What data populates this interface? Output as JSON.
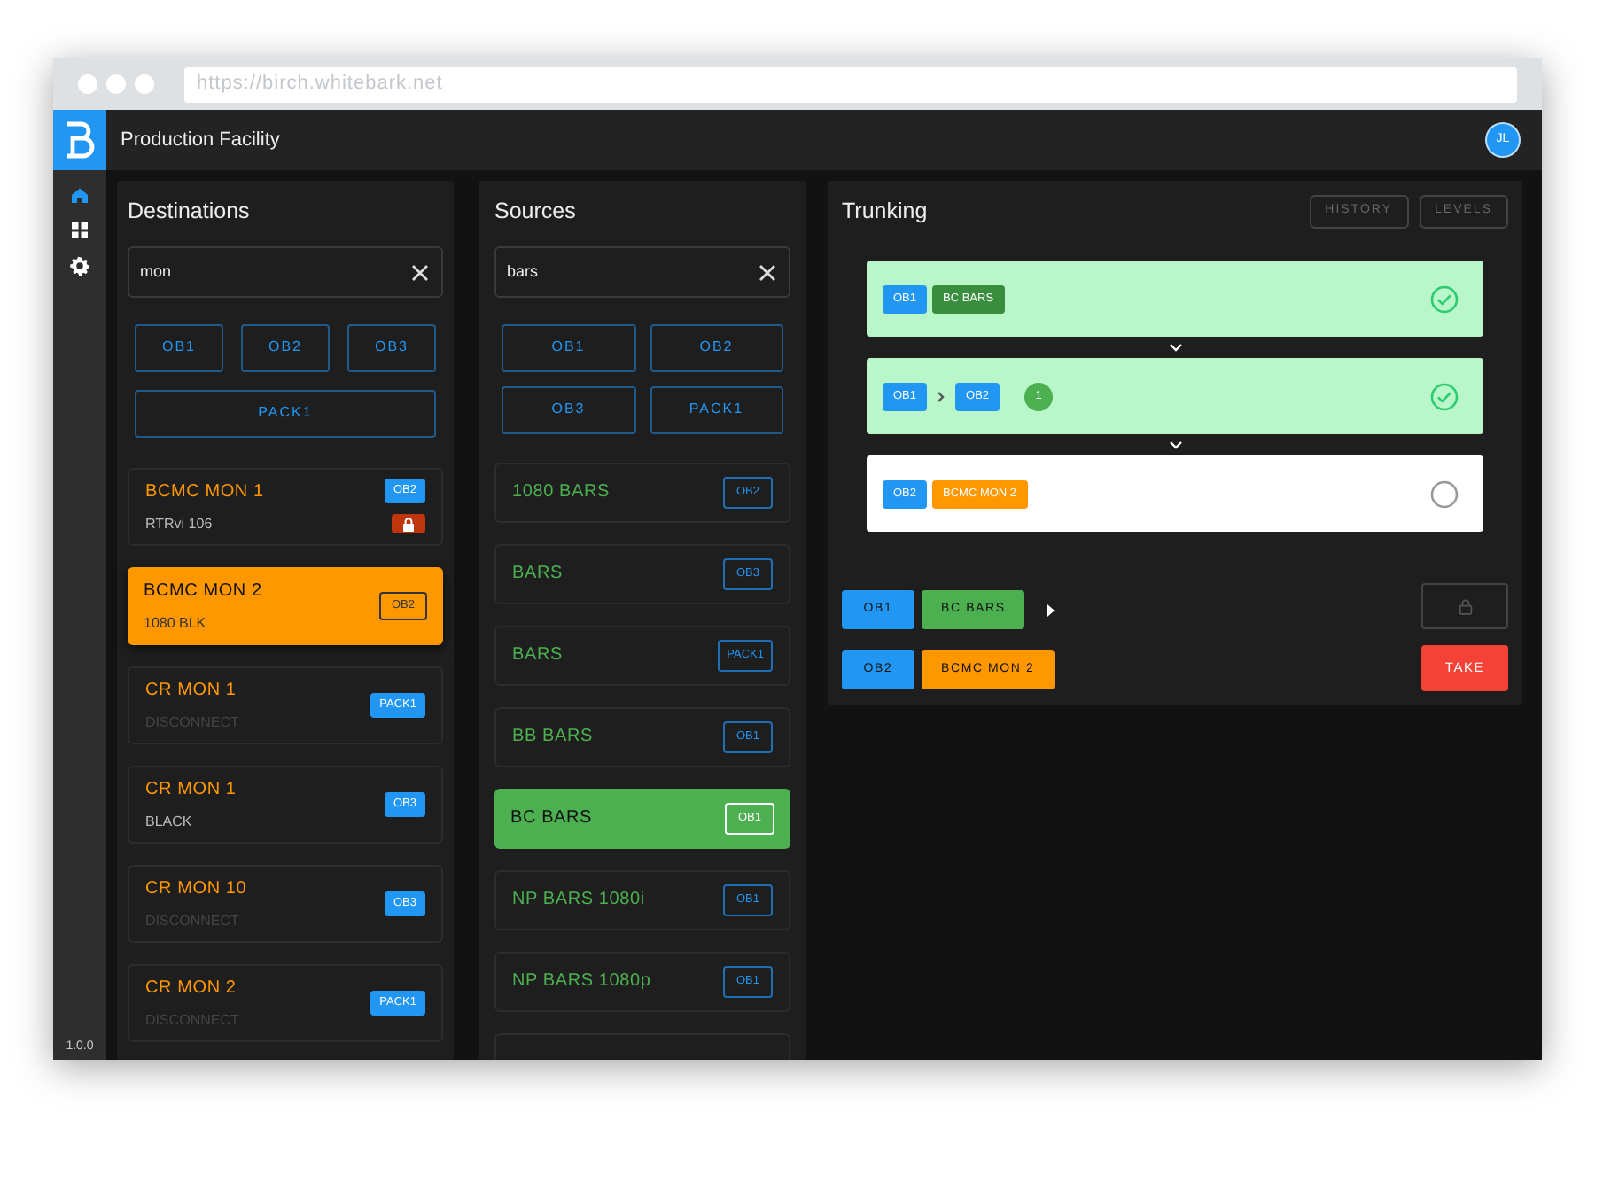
{
  "browser": {
    "url": "https://birch.whitebark.net"
  },
  "app": {
    "title": "Production Facility",
    "avatar": "JL",
    "version": "1.0.0"
  },
  "nav": [
    {
      "selected": true
    },
    {
      "selected": false
    },
    {
      "selected": false
    }
  ],
  "destinations": {
    "title": "Destinations",
    "search": "mon",
    "filters": [
      {
        "label": "OB1",
        "selected": false
      },
      {
        "label": "OB2",
        "selected": false
      },
      {
        "label": "OB3",
        "selected": false
      },
      {
        "label": "PACK1",
        "selected": false
      }
    ],
    "items": [
      {
        "title": "BCMC MON 1",
        "subtitle": "RTRvi 106",
        "tag": "OB2",
        "locked": true,
        "selected": false,
        "dim": false
      },
      {
        "title": "BCMC MON 2",
        "subtitle": "1080 BLK",
        "tag": "OB2",
        "locked": false,
        "selected": true,
        "dim": false
      },
      {
        "title": "CR MON 1",
        "subtitle": "DISCONNECT",
        "tag": "PACK1",
        "locked": false,
        "selected": false,
        "dim": true
      },
      {
        "title": "CR MON 1",
        "subtitle": "BLACK",
        "tag": "OB3",
        "locked": false,
        "selected": false,
        "dim": false
      },
      {
        "title": "CR MON 10",
        "subtitle": "DISCONNECT",
        "tag": "OB3",
        "locked": false,
        "selected": false,
        "dim": true
      },
      {
        "title": "CR MON 2",
        "subtitle": "DISCONNECT",
        "tag": "PACK1",
        "locked": false,
        "selected": false,
        "dim": true
      }
    ]
  },
  "sources": {
    "title": "Sources",
    "search": "bars",
    "filters": [
      {
        "label": "OB1",
        "selected": false
      },
      {
        "label": "OB2",
        "selected": false
      },
      {
        "label": "OB3",
        "selected": false
      },
      {
        "label": "PACK1",
        "selected": false
      }
    ],
    "items": [
      {
        "title": "1080 BARS",
        "tag": "OB2",
        "selected": false
      },
      {
        "title": "BARS",
        "tag": "OB3",
        "selected": false
      },
      {
        "title": "BARS",
        "tag": "PACK1",
        "selected": false
      },
      {
        "title": "BB BARS",
        "tag": "OB1",
        "selected": false
      },
      {
        "title": "BC BARS",
        "tag": "OB1",
        "selected": true
      },
      {
        "title": "NP BARS 1080i",
        "tag": "OB1",
        "selected": false
      },
      {
        "title": "NP BARS 1080p",
        "tag": "OB1",
        "selected": false
      }
    ]
  },
  "trunking": {
    "title": "Trunking",
    "buttons": [
      {
        "label": "HISTORY",
        "disabled": true
      },
      {
        "label": "LEVELS",
        "disabled": true
      }
    ],
    "steps": [
      {
        "kind": "source",
        "tags": [
          {
            "label": "OB1",
            "kind": "group"
          },
          {
            "label": "BC BARS",
            "kind": "source"
          }
        ],
        "done": true
      },
      {
        "kind": "trunk",
        "tags": [
          {
            "label": "OB1",
            "kind": "group"
          },
          {
            "label": "OB2",
            "kind": "group"
          }
        ],
        "count": "1",
        "done": true
      },
      {
        "kind": "destination",
        "tags": [
          {
            "label": "OB2",
            "kind": "group"
          },
          {
            "label": "BCMC MON 2",
            "kind": "destination"
          }
        ],
        "done": false
      }
    ],
    "route": [
      {
        "tags": [
          {
            "label": "OB1",
            "kind": "group"
          },
          {
            "label": "BC BARS",
            "kind": "source"
          }
        ],
        "play": true
      },
      {
        "tags": [
          {
            "label": "OB2",
            "kind": "group"
          },
          {
            "label": "BCMC MON 2",
            "kind": "destination"
          }
        ],
        "play": false
      }
    ],
    "locked": false,
    "take": "TAKE"
  }
}
